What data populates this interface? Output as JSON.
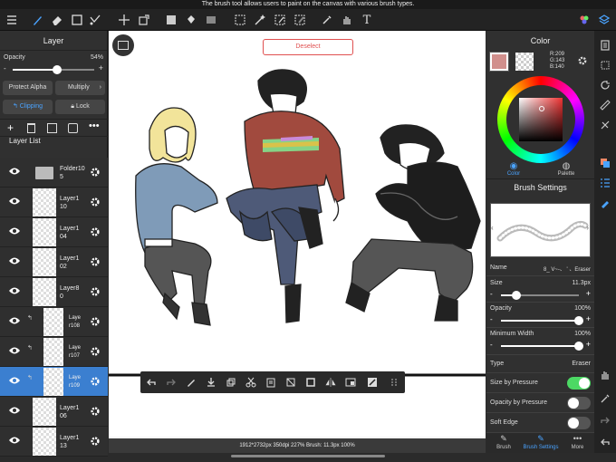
{
  "tooltip": "The brush tool allows users to paint on the canvas with various brush types.",
  "layer_panel": {
    "title": "Layer",
    "opacity_label": "Opacity",
    "opacity_value": "54%",
    "opacity_fraction": 0.54,
    "protect_alpha": "Protect Alpha",
    "blend_mode": "Multiply",
    "clipping": "Clipping",
    "lock": "Lock",
    "list_title": "Layer List",
    "layers": [
      {
        "name": "Folder10\n5",
        "type": "folder",
        "selected": false
      },
      {
        "name": "Layer1\n10",
        "type": "layer",
        "selected": false
      },
      {
        "name": "Layer1\n04",
        "type": "layer",
        "selected": false
      },
      {
        "name": "Layer1\n02",
        "type": "layer",
        "selected": false
      },
      {
        "name": "Layer8\n0",
        "type": "layer",
        "selected": false
      },
      {
        "name": "Laye\nr108",
        "type": "clip",
        "selected": false
      },
      {
        "name": "Laye\nr107",
        "type": "clip",
        "selected": false
      },
      {
        "name": "Laye\nr109",
        "type": "clip",
        "selected": true
      },
      {
        "name": "Layer1\n06",
        "type": "layer",
        "selected": false
      },
      {
        "name": "Layer1\n13",
        "type": "layer",
        "selected": false
      }
    ]
  },
  "canvas": {
    "deselect": "Deselect",
    "status": "1912*2732px 350dpi 227% Brush: 11.3px 100%"
  },
  "color_panel": {
    "title": "Color",
    "rgb": "R:209\nG:143\nB:140",
    "main_color": "#d18f8c",
    "tabs": [
      "Color",
      "Palette"
    ]
  },
  "brush_settings": {
    "title": "Brush Settings",
    "name_label": "Name",
    "name_value": "8_ V~-、 ' 、Eraser",
    "size_label": "Size",
    "size_value": "11.3px",
    "size_fraction": 0.2,
    "opacity_label": "Opacity",
    "opacity_value": "100%",
    "opacity_fraction": 1.0,
    "minwidth_label": "Minimum Width",
    "minwidth_value": "100%",
    "minwidth_fraction": 1.0,
    "type_label": "Type",
    "type_value": "Eraser",
    "size_by_pressure": "Size by Pressure",
    "size_by_pressure_on": true,
    "opacity_by_pressure": "Opacity by Pressure",
    "opacity_by_pressure_on": false,
    "soft_edge": "Soft Edge",
    "soft_edge_on": false
  },
  "bottom_tabs": [
    "Brush",
    "Brush Settings",
    "More"
  ],
  "colors": {
    "accent": "#3b7fd0",
    "toggle_on": "#4cd964"
  }
}
